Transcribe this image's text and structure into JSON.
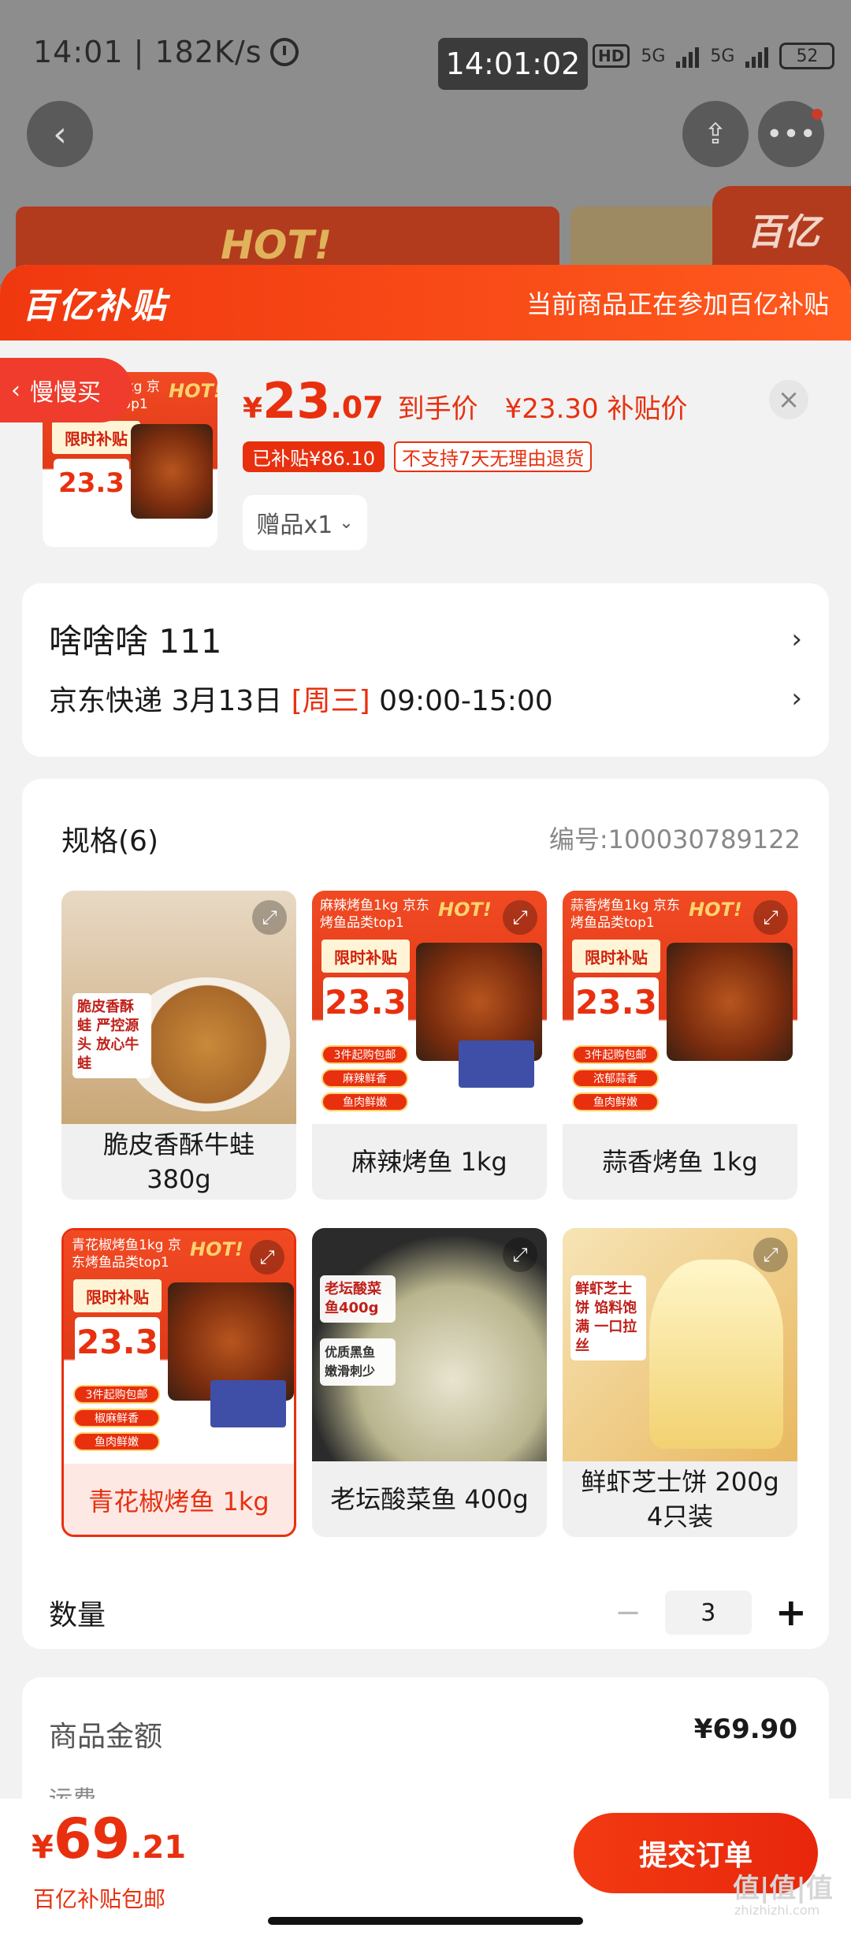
{
  "status_bar": {
    "left": "14:01 | 182K/s",
    "time_chip": "14:01:02",
    "hd": "HD",
    "net1": "5G",
    "net2": "5G",
    "battery": "52"
  },
  "background": {
    "banner_hot": "HOT!",
    "corner_badge": "百亿补贴"
  },
  "sheet": {
    "logo": "百亿补贴",
    "note": "当前商品正在参加百亿补贴",
    "price": {
      "yen": "¥",
      "int": "23",
      "dec": ".07",
      "label": "到手价",
      "subsidy": "¥23.30 补贴价"
    },
    "tags": {
      "subsidized": "已补贴¥86.10",
      "no_return": "不支持7天无理由退货"
    },
    "gift": "赠品x1",
    "close": "×"
  },
  "address": {
    "name": "啥啥啥  111",
    "courier": "京东快递 3月13日",
    "day": "[周三]",
    "time": "09:00-15:00"
  },
  "slow_buy": "慢慢买",
  "spec": {
    "title": "规格(6)",
    "code": "编号:100030789122",
    "items": [
      {
        "name": "脆皮香酥牛蛙 380g",
        "art": {
          "tag": "脆皮香酥蛙 严控源头 放心牛蛙"
        }
      },
      {
        "name": "麻辣烤鱼 1kg",
        "art": {
          "hdr": "麻辣烤鱼1kg 京东烤鱼品类top1",
          "hot": "HOT!",
          "promo": "限时补贴",
          "big": "23.3",
          "p1": "3件起购包邮",
          "p2": "麻辣鲜香",
          "p3": "鱼肉鲜嫩"
        }
      },
      {
        "name": "蒜香烤鱼 1kg",
        "art": {
          "hdr": "蒜香烤鱼1kg 京东烤鱼品类top1",
          "hot": "HOT!",
          "promo": "限时补贴",
          "big": "23.3",
          "p1": "3件起购包邮",
          "p2": "浓郁蒜香",
          "p3": "鱼肉鲜嫩"
        }
      },
      {
        "name": "青花椒烤鱼 1kg",
        "selected": true,
        "art": {
          "hdr": "青花椒烤鱼1kg 京东烤鱼品类top1",
          "hot": "HOT!",
          "promo": "限时补贴",
          "big": "23.3",
          "p1": "3件起购包邮",
          "p2": "椒麻鲜香",
          "p3": "鱼肉鲜嫩"
        }
      },
      {
        "name": "老坛酸菜鱼 400g",
        "art": {
          "tag": "老坛酸菜鱼400g",
          "tag2": "优质黑鱼 嫩滑刺少"
        }
      },
      {
        "name": "鲜虾芝士饼 200g 4只装",
        "art": {
          "tag": "鲜虾芝士饼 馅料饱满 一口拉丝"
        }
      }
    ]
  },
  "quantity": {
    "label": "数量",
    "minus": "−",
    "value": "3",
    "plus": "+"
  },
  "amount": {
    "label": "商品金额",
    "value": "¥69.90",
    "next": "运费"
  },
  "footer": {
    "price": {
      "yen": "¥",
      "int": "69",
      "dec": ".21"
    },
    "note": "百亿补贴包邮",
    "submit": "提交订单",
    "watermark": "值|值|值",
    "watermark_sub": "zhizhizhi.com"
  },
  "colors": {
    "accent": "#e8300f",
    "header": "#f0380f"
  }
}
